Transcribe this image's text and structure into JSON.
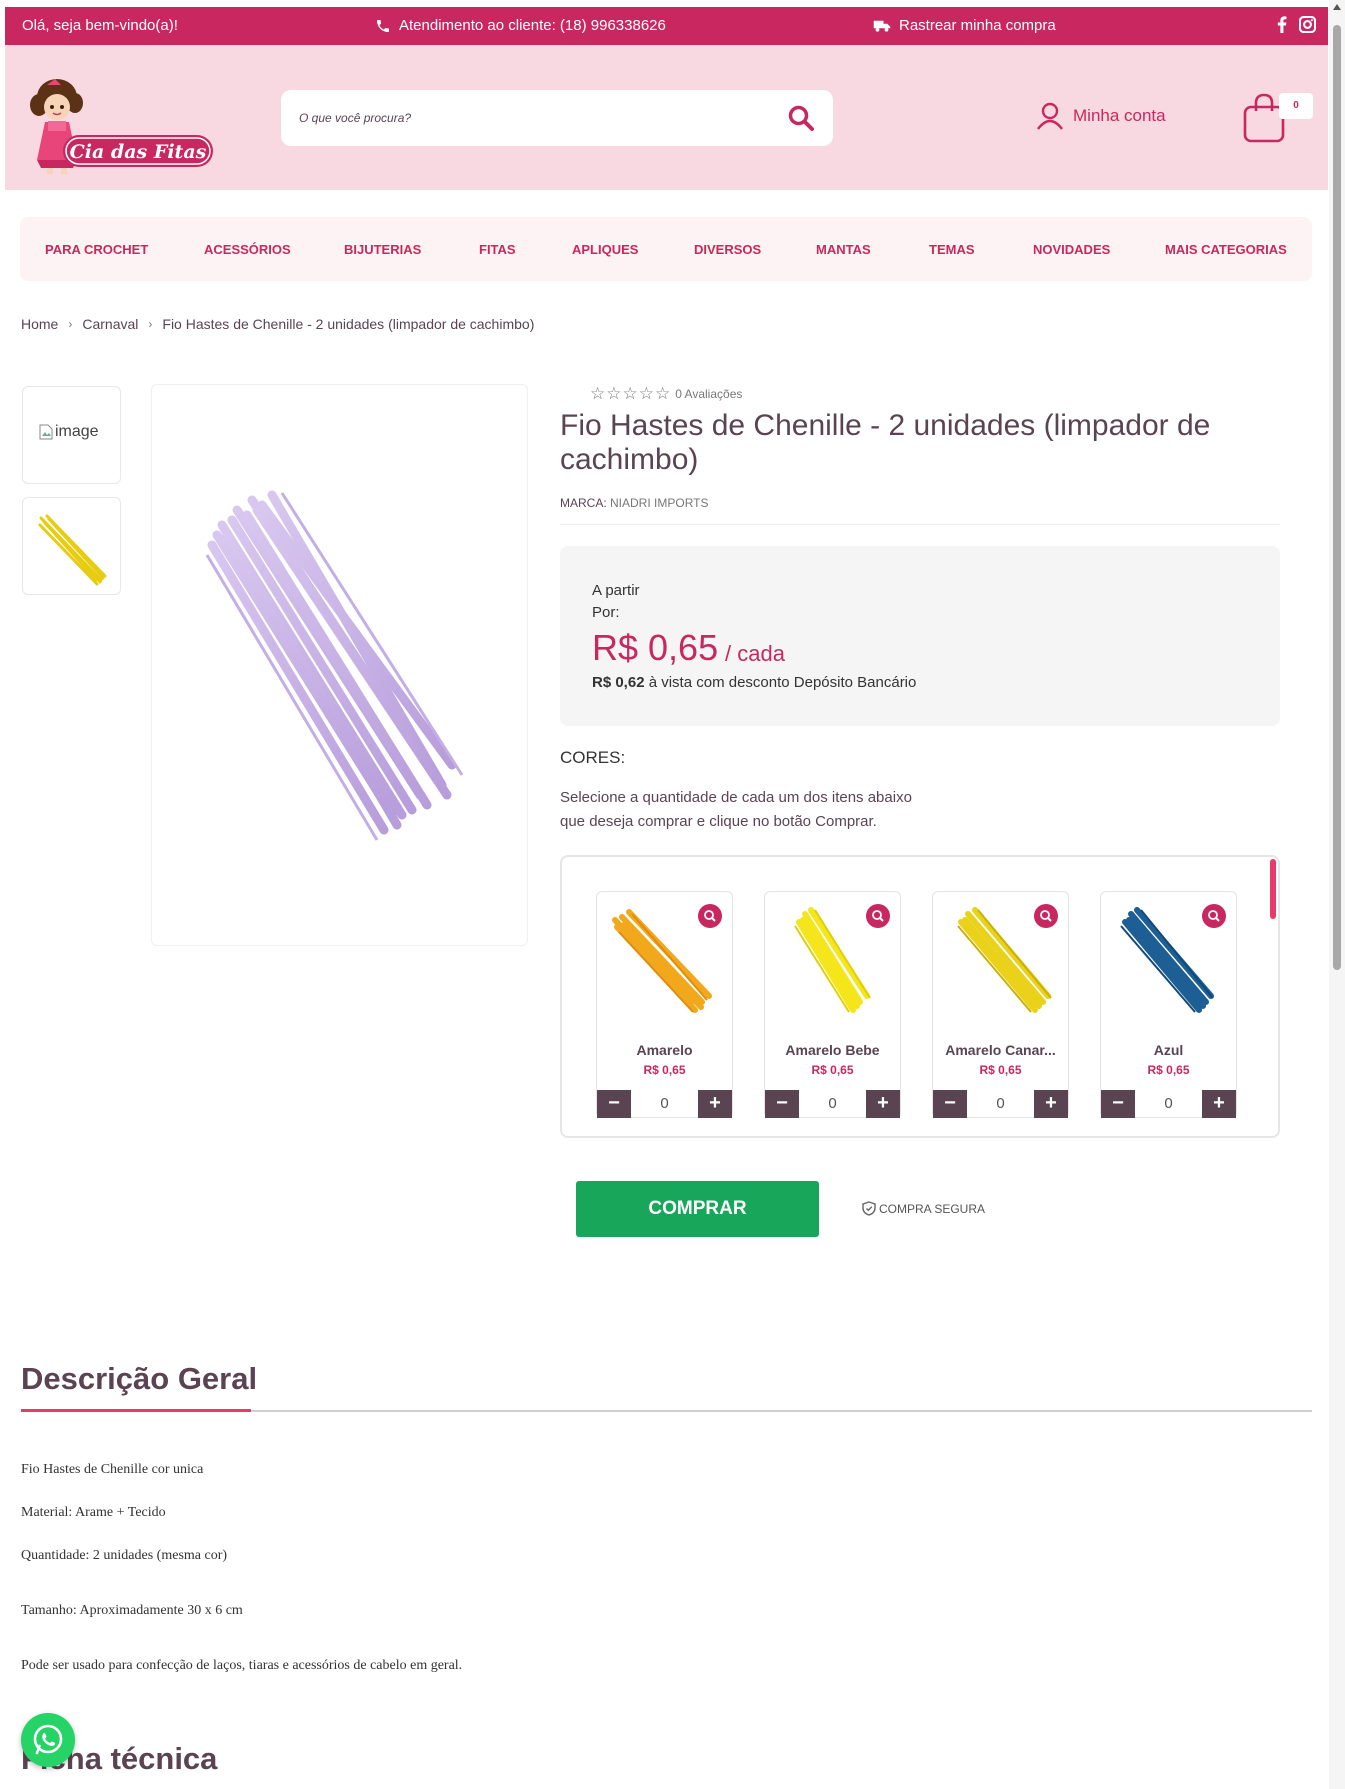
{
  "topbar": {
    "greeting": "Olá, seja bem-vindo(a)!",
    "support": "Atendimento ao cliente: (18) 996338626",
    "track": "Rastrear minha compra",
    "bg_color": "#c8285f"
  },
  "header": {
    "logo_text": "Cia das Fitas",
    "search_placeholder": "O que você procura?",
    "account_label": "Minha conta",
    "cart_count": "0",
    "bg_color": "#f8d9e2"
  },
  "nav": {
    "items": [
      "PARA CROCHET",
      "ACESSÓRIOS",
      "BIJUTERIAS",
      "FITAS",
      "APLIQUES",
      "DIVERSOS",
      "MANTAS",
      "TEMAS",
      "NOVIDADES",
      "MAIS CATEGORIAS"
    ]
  },
  "breadcrumb": {
    "items": [
      "Home",
      "Carnaval",
      "Fio Hastes de Chenille - 2 unidades (limpador de cachimbo)"
    ],
    "separator": "›"
  },
  "gallery": {
    "thumb_alt": "image"
  },
  "product": {
    "reviews": "0 Avaliações",
    "stars_filled": 0,
    "title": "Fio Hastes de Chenille - 2 unidades (limpador de cachimbo)",
    "brand_label": "MARCA:",
    "brand_value": "NIADRI IMPORTS",
    "price_from": "A partir",
    "price_por": "Por:",
    "price": "R$ 0,65",
    "price_unit": "/ cada",
    "cash_price": "R$ 0,62",
    "cash_text": "à vista com desconto Depósito Bancário",
    "options_label": "CORES:",
    "instructions_1": "Selecione a quantidade de cada um dos itens abaixo",
    "instructions_2": "que deseja comprar e clique no botão Comprar."
  },
  "variants": [
    {
      "name": "Amarelo",
      "price": "R$ 0,65",
      "qty": "0",
      "color": "#f2a81c"
    },
    {
      "name": "Amarelo Bebe",
      "price": "R$ 0,65",
      "qty": "0",
      "color": "#f4e61a"
    },
    {
      "name": "Amarelo Canar...",
      "price": "R$ 0,65",
      "qty": "0",
      "color": "#ead21a"
    },
    {
      "name": "Azul",
      "price": "R$ 0,65",
      "qty": "0",
      "color": "#1d5f95"
    }
  ],
  "actions": {
    "buy": "COMPRAR",
    "secure": "COMPRA SEGURA"
  },
  "description": {
    "heading": "Descrição Geral",
    "lines": [
      "Fio Hastes de Chenille cor unica",
      "Material: Arame + Tecido",
      "Quantidade: 2 unidades (mesma cor)",
      "Tamanho: Aproximadamente 30 x 6 cm",
      "Pode ser usado para confecção de laços, tiaras e acessórios de cabelo em geral."
    ],
    "heading2": "Ficha técnica"
  },
  "colors": {
    "brand": "#c8285f",
    "buy_button": "#17a65a",
    "main_image": "#c9b3e6",
    "thumb_image": "#ead21a"
  }
}
